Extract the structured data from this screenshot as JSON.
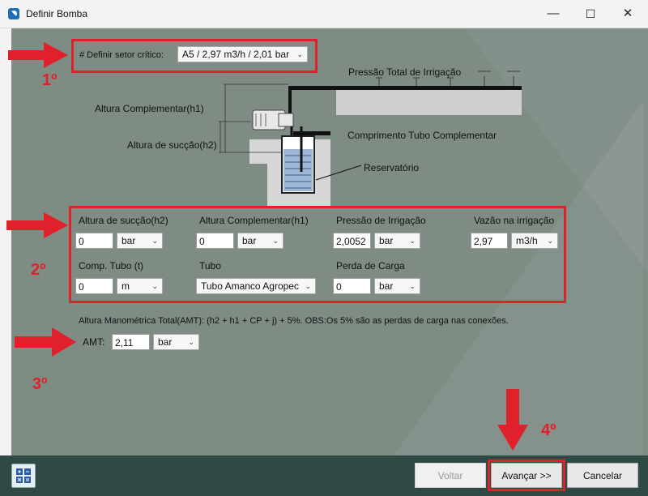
{
  "window": {
    "title": "Definir Bomba"
  },
  "titlebar": {
    "minimize": "—",
    "maximize": "☐",
    "close": "✕"
  },
  "steps": {
    "s1": "1º",
    "s2": "2º",
    "s3": "3º",
    "s4": "4º"
  },
  "critical_sector": {
    "label": "# Definir setor crítico:",
    "value": "A5 / 2,97 m3/h / 2,01 bar"
  },
  "diagram": {
    "pressure_label": "Pressão Total de Irrigação",
    "h1_label": "Altura Complementar(h1)",
    "h2_label": "Altura de sucção(h2)",
    "pipe_label": "Comprimento Tubo Complementar",
    "reservoir_label": "Reservatório"
  },
  "form": {
    "suction_height": {
      "label": "Altura de sucção(h2)",
      "value": "0",
      "unit": "bar"
    },
    "complementary_height": {
      "label": "Altura Complementar(h1)",
      "value": "0",
      "unit": "bar"
    },
    "irrigation_pressure": {
      "label": "Pressão de Irrigação",
      "value": "2,0052",
      "unit": "bar"
    },
    "irrigation_flow": {
      "label": "Vazão na irrigação",
      "value": "2,97",
      "unit": "m3/h"
    },
    "pipe_length": {
      "label": "Comp. Tubo (t)",
      "value": "0",
      "unit": "m"
    },
    "pipe": {
      "label": "Tubo",
      "value": "Tubo Amanco Agropec"
    },
    "head_loss": {
      "label": "Perda de Carga",
      "value": "0",
      "unit": "bar"
    }
  },
  "amt": {
    "description": "Altura Manométrica Total(AMT): (h2 + h1 + CP + j) + 5%. OBS:Os 5% são as perdas de carga nas conexões.",
    "label": "AMT:",
    "value": "2,11",
    "unit": "bar"
  },
  "footer": {
    "back": "Voltar",
    "next": "Avançar >>",
    "cancel": "Cancelar"
  },
  "colors": {
    "highlight": "#e0202a",
    "panel": "#7e8c84",
    "frame": "#2f4a44"
  },
  "icons": {
    "app": "app-icon",
    "calculator": "calculator-icon",
    "dropdown": "chevron-down-icon"
  }
}
